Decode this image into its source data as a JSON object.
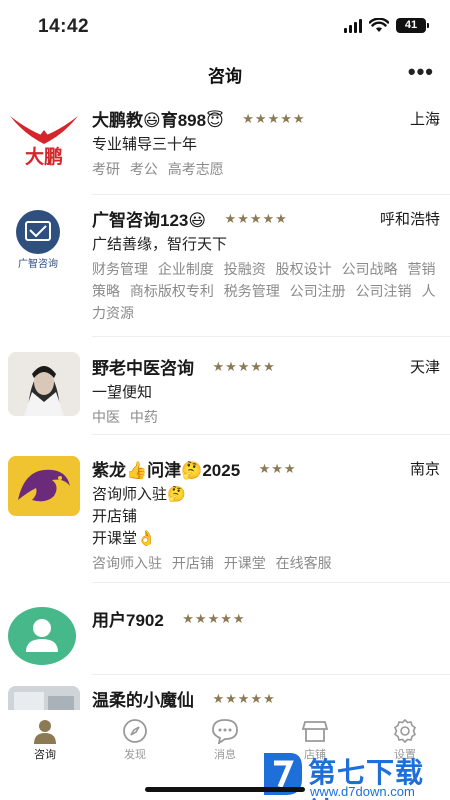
{
  "status_bar": {
    "time": "14:42",
    "battery": "41"
  },
  "header": {
    "title": "咨询",
    "more": "•••"
  },
  "consultants": [
    {
      "name": "大鹏教😃育898😇",
      "stars": "★★★★★",
      "city": "上海",
      "descriptions": [
        "专业辅导三十年"
      ],
      "tags": [
        "考研",
        "考公",
        "高考志愿"
      ]
    },
    {
      "name": "广智咨询123😃",
      "stars": "★★★★★",
      "city": "呼和浩特",
      "descriptions": [
        "广结善缘，智行天下"
      ],
      "tags": [
        "财务管理",
        "企业制度",
        "投融资",
        "股权设计",
        "公司战略",
        "营销策略",
        "商标版权专利",
        "税务管理",
        "公司注册",
        "公司注销",
        "人力资源"
      ],
      "avatar_text": "广智咨询"
    },
    {
      "name": "野老中医咨询",
      "stars": "★★★★★",
      "city": "天津",
      "descriptions": [
        "一望便知"
      ],
      "tags": [
        "中医",
        "中药"
      ]
    },
    {
      "name": "紫龙👍问津🤔2025",
      "stars": "★★★",
      "city": "南京",
      "descriptions": [
        "咨询师入驻🤔",
        "开店铺",
        "开课堂👌"
      ],
      "tags": [
        "咨询师入驻",
        "开店铺",
        "开课堂",
        "在线客服"
      ]
    },
    {
      "name": "用户7902",
      "stars": "★★★★★",
      "city": "",
      "descriptions": [],
      "tags": []
    },
    {
      "name": "温柔的小魔仙",
      "stars": "★★★★★",
      "city": "",
      "descriptions": [],
      "tags": []
    }
  ],
  "tab_bar": {
    "items": [
      {
        "label": "咨询",
        "icon": "person-icon",
        "active": true
      },
      {
        "label": "发现",
        "icon": "compass-icon",
        "active": false
      },
      {
        "label": "消息",
        "icon": "chat-bubble-icon",
        "active": false
      },
      {
        "label": "店铺",
        "icon": "store-icon",
        "active": false
      },
      {
        "label": "设置",
        "icon": "gear-icon",
        "active": false
      }
    ]
  },
  "watermark": {
    "main": "第七下载站",
    "sub": "www.d7down.com"
  },
  "colors": {
    "stars": "#8c7a55",
    "tags": "#8a8a8a",
    "watermark": "#1e6fd9",
    "logo_red": "#d4262b"
  }
}
